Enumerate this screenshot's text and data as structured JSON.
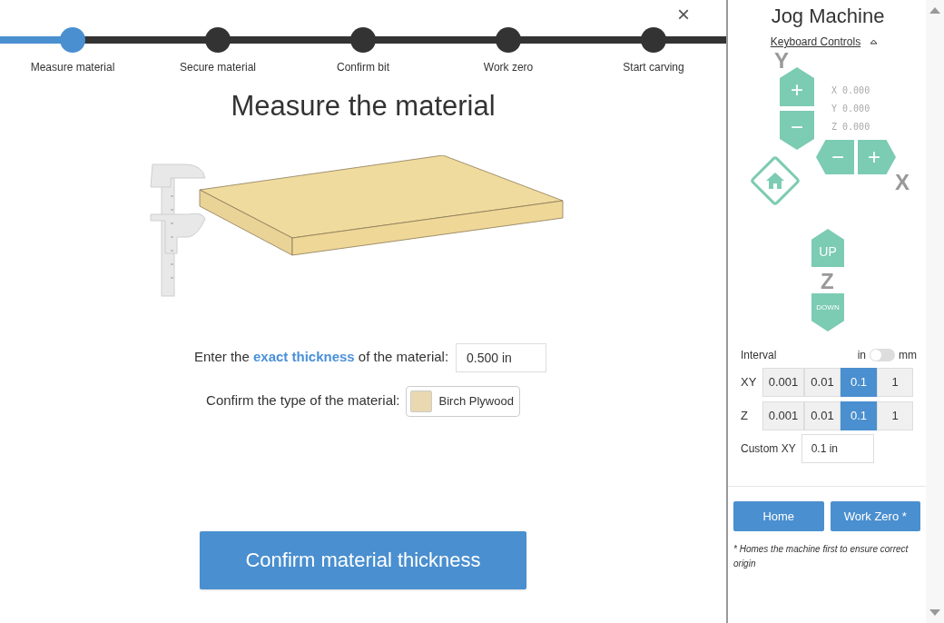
{
  "close": "×",
  "steps": [
    {
      "label": "Measure material",
      "selected": true
    },
    {
      "label": "Secure material",
      "selected": false
    },
    {
      "label": "Confirm bit",
      "selected": false
    },
    {
      "label": "Work zero",
      "selected": false
    },
    {
      "label": "Start carving",
      "selected": false
    }
  ],
  "heading": "Measure the material",
  "thickness": {
    "before": "Enter the ",
    "link": "exact thickness",
    "after": " of the material:",
    "value": "0.500 in"
  },
  "material": {
    "label": "Confirm the type of the material:",
    "value": "Birch Plywood",
    "color": "#ead8b0"
  },
  "confirm_button": "Confirm material thickness",
  "sidebar": {
    "title": "Jog Machine",
    "keyboard_controls": {
      "label": "Keyboard Controls",
      "expanded": true
    },
    "axes": {
      "y": "Y",
      "x": "X",
      "z": "Z"
    },
    "jog_buttons": {
      "y_plus": "+",
      "y_minus": "−",
      "x_minus": "−",
      "x_plus": "+",
      "z_up": "UP",
      "z_down": "DOWN"
    },
    "readouts": [
      {
        "axis": "X",
        "value": "0.000"
      },
      {
        "axis": "Y",
        "value": "0.000"
      },
      {
        "axis": "Z",
        "value": "0.000"
      }
    ],
    "interval": {
      "label": "Interval",
      "unit_left": "in",
      "unit_right": "mm",
      "on": false
    },
    "interval_rows": [
      {
        "label": "XY",
        "options": [
          {
            "value": "0.001",
            "selected": false
          },
          {
            "value": "0.01",
            "selected": false
          },
          {
            "value": "0.1",
            "selected": true
          },
          {
            "value": "1",
            "selected": false
          }
        ]
      },
      {
        "label": "Z",
        "options": [
          {
            "value": "0.001",
            "selected": false
          },
          {
            "value": "0.01",
            "selected": false
          },
          {
            "value": "0.1",
            "selected": true
          },
          {
            "value": "1",
            "selected": false
          }
        ]
      }
    ],
    "custom": {
      "label": "Custom XY",
      "value": "0.1 in"
    },
    "buttons": [
      "Home",
      "Work Zero *"
    ],
    "footnote": "* Homes the machine first to ensure correct origin"
  }
}
